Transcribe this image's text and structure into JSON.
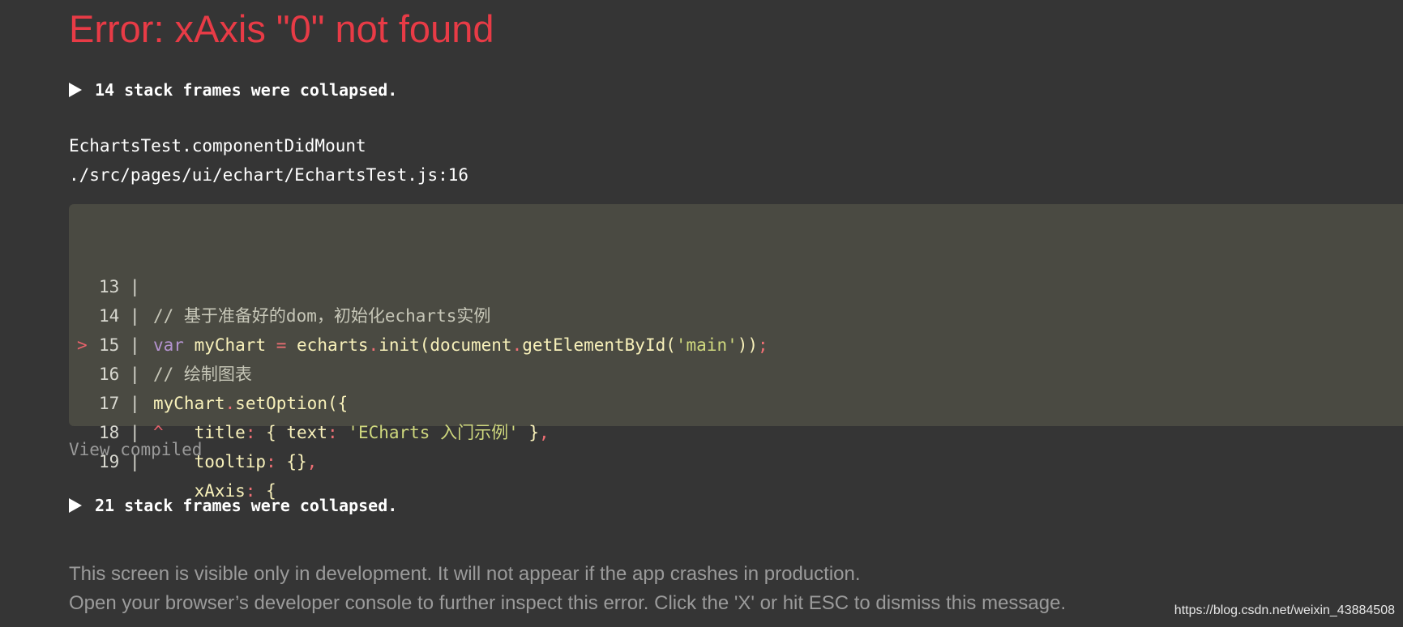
{
  "error": {
    "title": "Error: xAxis \"0\" not found"
  },
  "collapsed_frames": [
    {
      "label": "14 stack frames were collapsed."
    },
    {
      "label": "21 stack frames were collapsed."
    }
  ],
  "stack_frame": {
    "function": "EchartsTest.componentDidMount",
    "file": "./src/pages/ui/echart/EchartsTest.js:16"
  },
  "code_frame": {
    "lines": [
      {
        "number": "13",
        "marker": "",
        "text": "// 基于准备好的dom，初始化echarts实例"
      },
      {
        "number": "14",
        "marker": "",
        "text": "var myChart = echarts.init(document.getElementById('main'));"
      },
      {
        "number": "15",
        "marker": "",
        "text": "// 绘制图表"
      },
      {
        "number": "16",
        "marker": ">",
        "text": "myChart.setOption({"
      },
      {
        "number": "17",
        "marker": "",
        "text": "^   title: { text: 'ECharts 入门示例' },"
      },
      {
        "number": "18",
        "marker": "",
        "text": "    tooltip: {},"
      },
      {
        "number": "19",
        "marker": "",
        "text": "    xAxis: {"
      }
    ]
  },
  "view_compiled": "View compiled",
  "footer": {
    "line1": "This screen is visible only in development. It will not appear if the app crashes in production.",
    "line2": "Open your browser’s developer console to further inspect this error.  Click the 'X' or hit ESC to dismiss this message."
  },
  "watermark": "https://blog.csdn.net/weixin_43884508",
  "colors": {
    "background": "#353535",
    "error_red": "#e83b46",
    "code_background": "#4a4a42"
  }
}
